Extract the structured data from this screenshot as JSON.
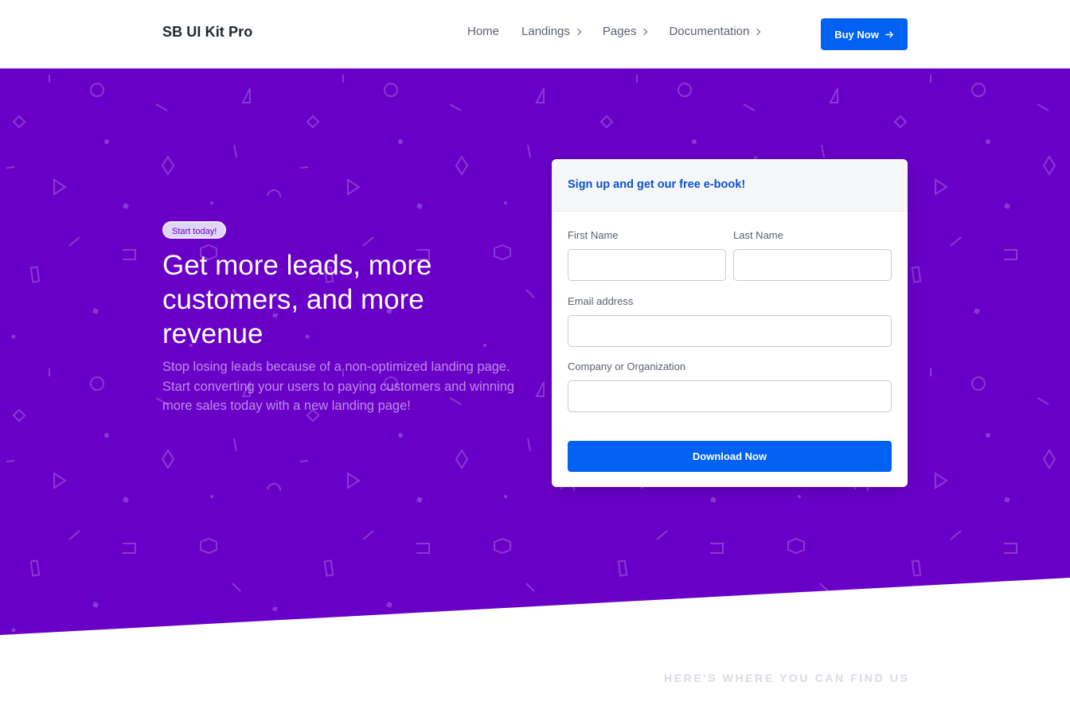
{
  "navbar": {
    "brand": "SB UI Kit Pro",
    "items": [
      {
        "label": "Home",
        "dropdown": false
      },
      {
        "label": "Landings",
        "dropdown": true
      },
      {
        "label": "Pages",
        "dropdown": true
      },
      {
        "label": "Documentation",
        "dropdown": true
      }
    ],
    "buy_label": "Buy Now"
  },
  "hero": {
    "badge": "Start today!",
    "title": "Get more leads, more customers, and more revenue",
    "subtitle": "Stop losing leads because of a non-optimized landing page. Start converting your users to paying customers and winning more sales today with a new landing page!",
    "bg_color": "#6900c7"
  },
  "signup_card": {
    "header": "Sign up and get our free e-book!",
    "first_name_label": "First Name",
    "first_name_value": "",
    "last_name_label": "Last Name",
    "last_name_value": "",
    "email_label": "Email address",
    "email_value": "",
    "company_label": "Company or Organization",
    "company_value": "",
    "submit_label": "Download Now"
  },
  "section": {
    "find_us": "HERE'S WHERE YOU CAN FIND US"
  },
  "colors": {
    "primary": "#0061f2",
    "hero_purple": "#6900c7",
    "card_header_text": "#0b52cf"
  }
}
